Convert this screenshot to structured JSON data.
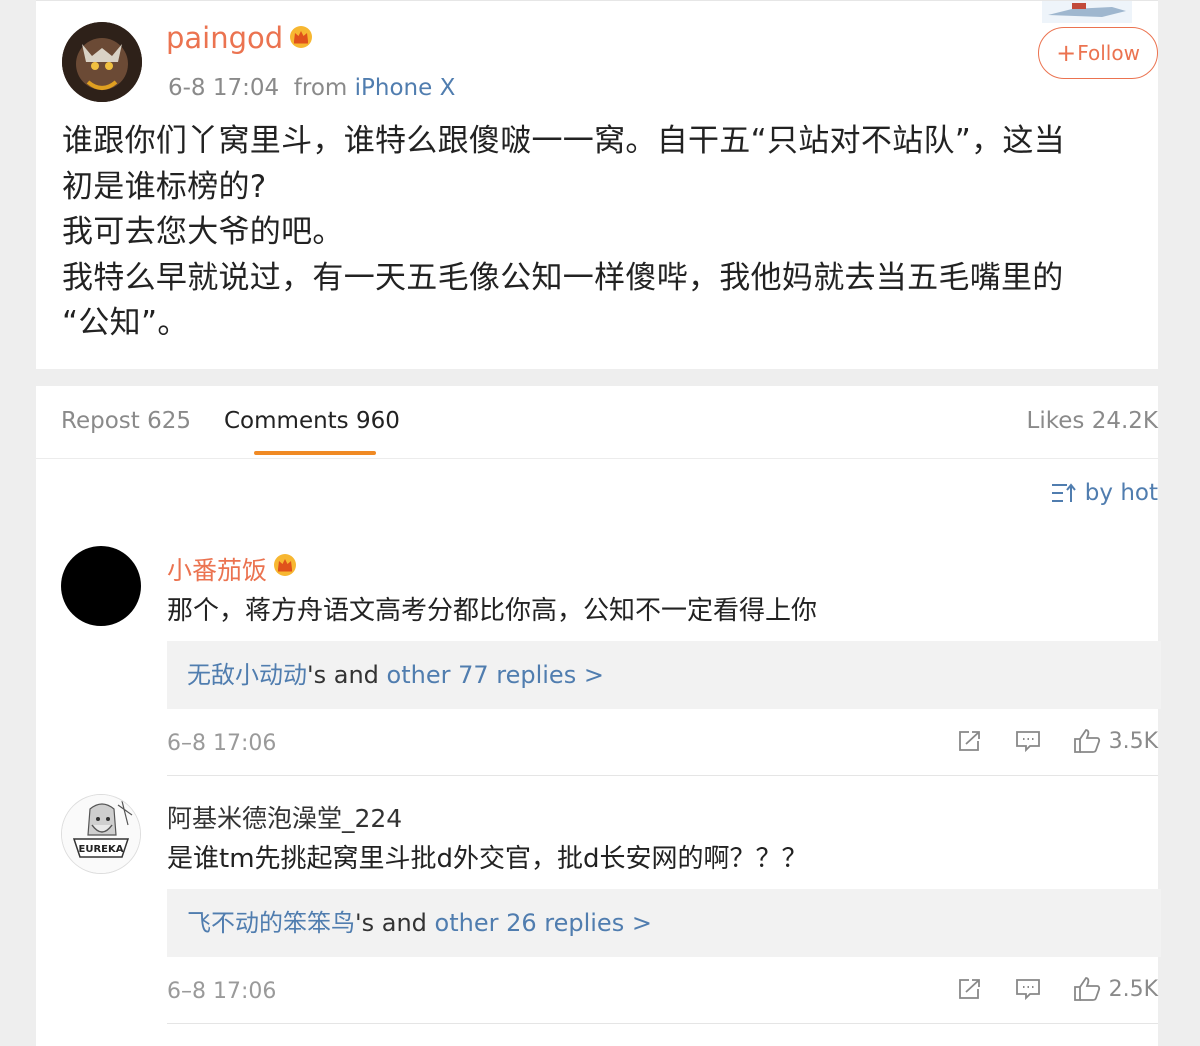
{
  "post": {
    "username": "paingod",
    "time": "6-8 17:04",
    "from_label": "from",
    "source": "iPhone X",
    "follow_label": "Follow",
    "body_lines": [
      "谁跟你们丫窝里斗，谁特么跟傻啵一一窝。自干五“只站对不站队”，这当",
      "初是谁标榜的?",
      "我可去您大爷的吧。",
      "我特么早就说过，有一天五毛像公知一样傻哔，我他妈就去当五毛嘴里的",
      "“公知”。"
    ]
  },
  "tabs": {
    "repost": "Repost 625",
    "comments": "Comments 960",
    "likes": "Likes 24.2K"
  },
  "sort_label": "by hot",
  "comments": [
    {
      "username": "小番茄饭",
      "text": "那个，蒋方舟语文高考分都比你高，公知不一定看得上你",
      "reply_user": "无敌小动动",
      "reply_mid": "'s and ",
      "reply_more": "other 77 replies >",
      "time": "6–8 17:06",
      "likes": "3.5K"
    },
    {
      "username": "阿基米德泡澡堂_224",
      "text": "是谁tm先挑起窝里斗批d外交官，批d长安网的啊？？？",
      "reply_user": "飞不动的笨笨鸟",
      "reply_mid": "'s and ",
      "reply_more": "other 26 replies >",
      "time": "6–8 17:06",
      "likes": "2.5K",
      "avatar_text": "EUREKA"
    }
  ],
  "colors": {
    "accent_orange": "#eb7350",
    "link_blue": "#507daf",
    "tab_underline": "#f08a24"
  }
}
